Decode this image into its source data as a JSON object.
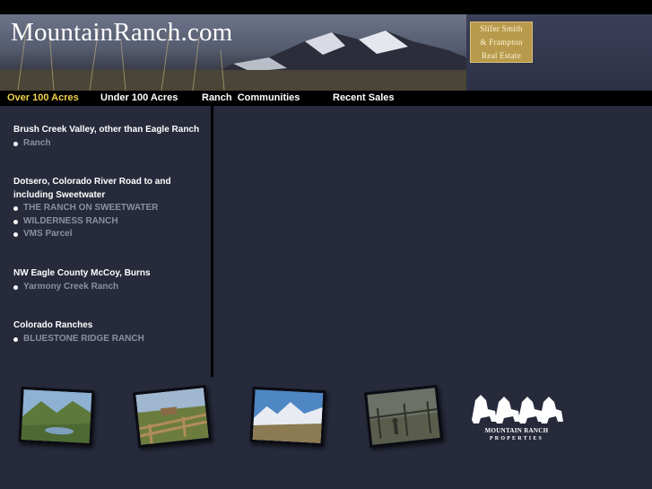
{
  "site": {
    "title": "MountainRanch.com",
    "firm_logo_lines": [
      "Slifer Smith",
      "& Frampton",
      "Real Estate"
    ],
    "brand_logo_text": [
      "Mountain Ranch",
      "Properties"
    ]
  },
  "nav": {
    "items": [
      {
        "label": "Over 100 Acres",
        "active": true
      },
      {
        "label": "Under 100 Acres",
        "active": false
      },
      {
        "label": "Ranch  Communities",
        "active": false
      },
      {
        "label": "Recent Sales",
        "active": false
      }
    ]
  },
  "sidebar": {
    "groups": [
      {
        "title": "Brush Creek Valley, other than Eagle Ranch",
        "links": [
          "Ranch"
        ]
      },
      {
        "title": "Dotsero, Colorado River Road to and including Sweetwater",
        "links": [
          "THE RANCH ON SWEETWATER",
          "WILDERNESS RANCH",
          "VMS Parcel"
        ]
      },
      {
        "title": "NW Eagle County McCoy, Burns",
        "links": [
          "Yarmony Creek Ranch"
        ]
      },
      {
        "title": "Colorado Ranches",
        "links": [
          "BLUESTONE RIDGE RANCH"
        ]
      }
    ]
  },
  "colors": {
    "background": "#262a3b",
    "nav_active": "#f2d24c",
    "link": "#8a8fa3",
    "firm_logo_gold": "#b89a4c"
  },
  "gallery": {
    "photos": [
      "valley-lake-photo",
      "ranch-fence-photo",
      "snowy-peaks-photo",
      "corral-photo"
    ]
  }
}
